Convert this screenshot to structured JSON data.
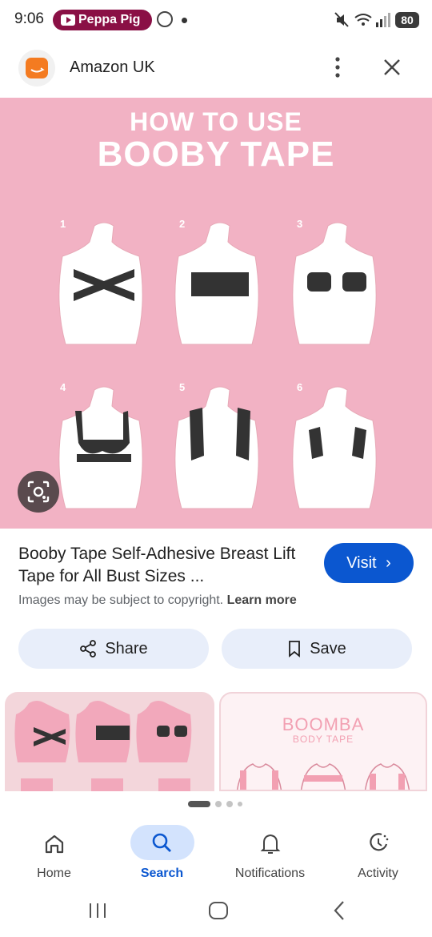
{
  "status_bar": {
    "time": "9:06",
    "media_pill": "Peppa Pig",
    "battery": "80"
  },
  "top_bar": {
    "source_name": "Amazon UK",
    "more_icon": "more-vert-icon",
    "close_icon": "close-icon"
  },
  "hero": {
    "heading_line1": "HOW TO USE",
    "heading_line2": "BOOBY TAPE",
    "step_numbers": [
      "1",
      "2",
      "3",
      "4",
      "5",
      "6"
    ]
  },
  "result": {
    "title": "Booby Tape Self-Adhesive Breast Lift Tape for All Bust Sizes ...",
    "visit_label": "Visit",
    "copyright_text": "Images may be subject to copyright.",
    "learn_more": "Learn more",
    "share_label": "Share",
    "save_label": "Save"
  },
  "related": {
    "thumb2_title": "BOOMBA",
    "thumb2_subtitle": "BODY TAPE"
  },
  "bottom_nav": {
    "items": [
      {
        "label": "Home",
        "icon": "home-icon"
      },
      {
        "label": "Search",
        "icon": "search-icon"
      },
      {
        "label": "Notifications",
        "icon": "bell-icon"
      },
      {
        "label": "Activity",
        "icon": "activity-icon"
      }
    ],
    "active": "Search"
  },
  "colors": {
    "hero_bg": "#f2b2c4",
    "accent": "#0b57d0",
    "pill_bg": "#e8eefa",
    "amazon_orange": "#f47b21",
    "media_pill": "#8a1045"
  }
}
